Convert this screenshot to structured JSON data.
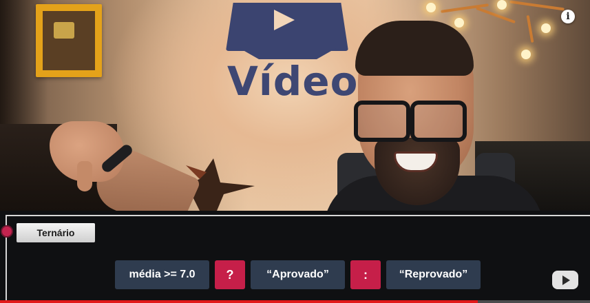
{
  "video": {
    "studio_logo_text": "Vídeo",
    "info_icon": "info-icon",
    "watermark_icon": "youtube-logo-icon"
  },
  "overlay": {
    "section_label": "Ternário",
    "tokens": {
      "condition": "média >= 7.0",
      "question_mark": "?",
      "true_value": "“Aprovado”",
      "colon": ":",
      "false_value": "“Reprovado”"
    },
    "colors": {
      "code_token": "#2f3c4f",
      "operator_token": "#c61f49",
      "section_dot": "#c2244f"
    }
  },
  "player": {
    "progress": 0.81,
    "progress_color": "#e11a1a"
  }
}
